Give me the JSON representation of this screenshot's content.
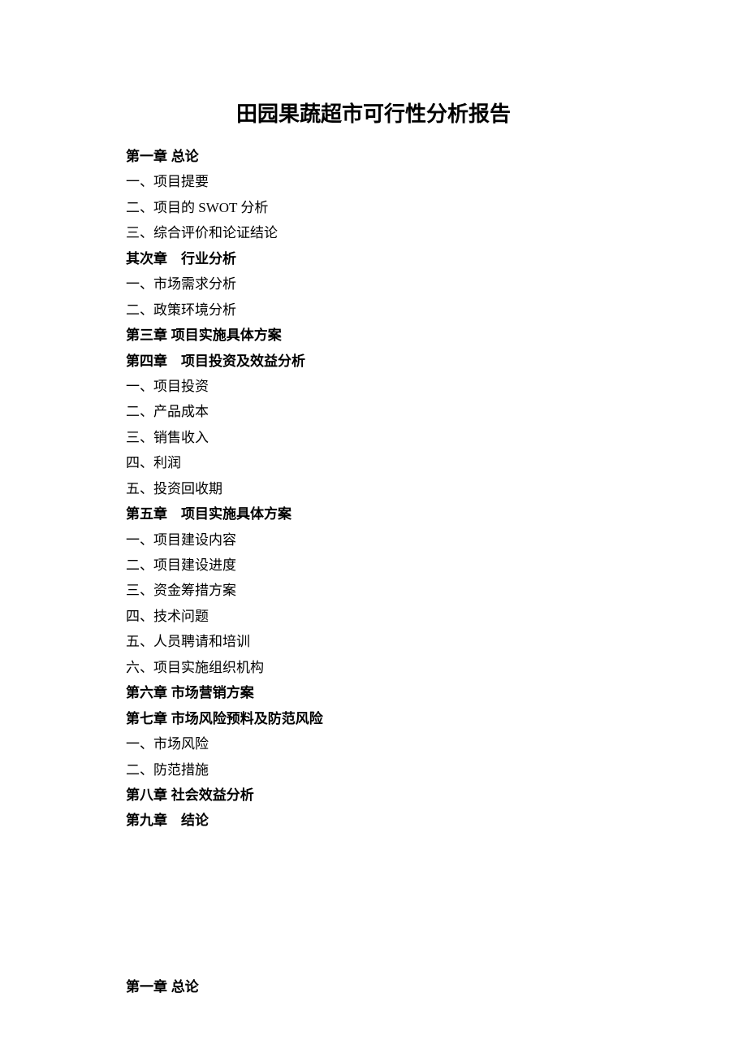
{
  "title": "田园果蔬超市可行性分析报告",
  "sections": [
    {
      "type": "chapter",
      "text": "第一章  总论"
    },
    {
      "type": "item",
      "text": "一、项目提要"
    },
    {
      "type": "item",
      "text": "二、项目的 SWOT 分析"
    },
    {
      "type": "item",
      "text": "三、综合评价和论证结论"
    },
    {
      "type": "chapter",
      "text": "其次章　行业分析"
    },
    {
      "type": "item",
      "text": "一、市场需求分析"
    },
    {
      "type": "item",
      "text": "二、政策环境分析"
    },
    {
      "type": "chapter",
      "text": "第三章  项目实施具体方案"
    },
    {
      "type": "chapter",
      "text": "第四章　项目投资及效益分析"
    },
    {
      "type": "item",
      "text": "一、项目投资"
    },
    {
      "type": "item",
      "text": "二、产品成本"
    },
    {
      "type": "item",
      "text": "三、销售收入"
    },
    {
      "type": "item",
      "text": "四、利润"
    },
    {
      "type": "item",
      "text": "五、投资回收期"
    },
    {
      "type": "chapter",
      "text": "第五章　项目实施具体方案"
    },
    {
      "type": "item",
      "text": "一、项目建设内容"
    },
    {
      "type": "item",
      "text": "二、项目建设进度"
    },
    {
      "type": "item",
      "text": "三、资金筹措方案"
    },
    {
      "type": "item",
      "text": "四、技术问题"
    },
    {
      "type": "item",
      "text": "五、人员聘请和培训"
    },
    {
      "type": "item",
      "text": "六、项目实施组织机构"
    },
    {
      "type": "chapter",
      "text": "第六章  市场营销方案"
    },
    {
      "type": "chapter",
      "text": "第七章  市场风险预料及防范风险"
    },
    {
      "type": "item",
      "text": "一、市场风险"
    },
    {
      "type": "item",
      "text": "二、防范措施"
    },
    {
      "type": "chapter",
      "text": "第八章  社会效益分析"
    },
    {
      "type": "chapter",
      "text": "第九章　结论"
    }
  ],
  "footer": "第一章  总论"
}
